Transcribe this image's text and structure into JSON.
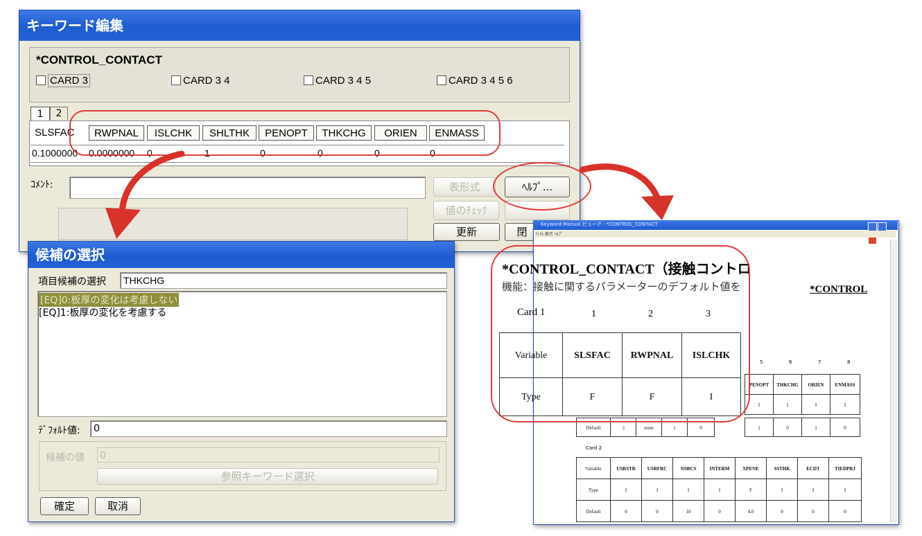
{
  "keyword_window": {
    "title": "キーワード編集",
    "keyword": "*CONTROL_CONTACT",
    "cards": [
      "CARD 3",
      "CARD 3 4",
      "CARD 3 4 5",
      "CARD 3 4 5 6"
    ],
    "tabs": [
      "1",
      "2"
    ],
    "columns": [
      "SLSFAC",
      "RWPNAL",
      "ISLCHK",
      "SHLTHK",
      "PENOPT",
      "THKCHG",
      "ORIEN",
      "ENMASS"
    ],
    "values": [
      "0.1000000",
      "0.0000000",
      "0",
      "1",
      "0",
      "0",
      "0",
      "0"
    ],
    "comment_label": "ｺﾒﾝﾄ:",
    "buttons": {
      "format": "表形式",
      "help": "ﾍﾙﾌﾟ...",
      "check": "値のﾁｪｯｸ",
      "update": "更新",
      "close": "閉"
    }
  },
  "candidate_window": {
    "title": "候補の選択",
    "item_label": "項目候補の選択",
    "item_value": "THKCHG",
    "options": [
      "[EQ]0:板厚の変化は考慮しない",
      "[EQ]1:板厚の変化を考慮する"
    ],
    "default_label": "ﾃﾞﾌｫﾙﾄ値:",
    "default_value": "0",
    "ref_label": "候補の値",
    "ref_value": "0",
    "ref_button": "参照キーワード選択",
    "ok": "確定",
    "cancel": "取消"
  },
  "manual_window": {
    "title": "Keyword Manual ビューア - *CONTROL_CONTACT",
    "menu": "ﾌｧｲﾙ 表示 ﾍﾙﾌﾟ",
    "heading": "*CONTROL_CONTACT（接触コントロ",
    "func": "機能：接触に関するパラメーターのデフォルト値を",
    "right_heading": "*CONTROL",
    "card1_label": "Card 1",
    "card1_cols": [
      "1",
      "2",
      "3"
    ],
    "card1_var_label": "Variable",
    "card1_vars": [
      "SLSFAC",
      "RWPNAL",
      "ISLCHK"
    ],
    "card1_type_label": "Type",
    "card1_types": [
      "F",
      "F",
      "I"
    ],
    "card1_right_cols": [
      "5",
      "6",
      "7",
      "8"
    ],
    "card1_right_vars": [
      "PENOPT",
      "THKCHG",
      "ORIEN",
      "ENMASS"
    ],
    "card1_right_types": [
      "I",
      "I",
      "I",
      "I"
    ],
    "default_row": [
      "Default",
      ".1",
      "none",
      "1",
      "0",
      "1",
      "0",
      "1",
      "0"
    ],
    "card2_label": "Card 2",
    "card2_vars": [
      "Variable",
      "USRSTR",
      "USRFRC",
      "NSBCS",
      "INTERM",
      "XPENE",
      "SSTHK",
      "ECDT",
      "TIEDPRJ"
    ],
    "card2_types": [
      "Type",
      "I",
      "I",
      "I",
      "I",
      "F",
      "I",
      "I",
      "I"
    ],
    "card2_defaults": [
      "Default",
      "0",
      "0",
      "10",
      "0",
      "4.0",
      "0",
      "0",
      "0"
    ]
  },
  "colors": {
    "arrow": "#d9322b",
    "title_blue": "#1f5bd1",
    "highlight": "#8f8f3a"
  }
}
